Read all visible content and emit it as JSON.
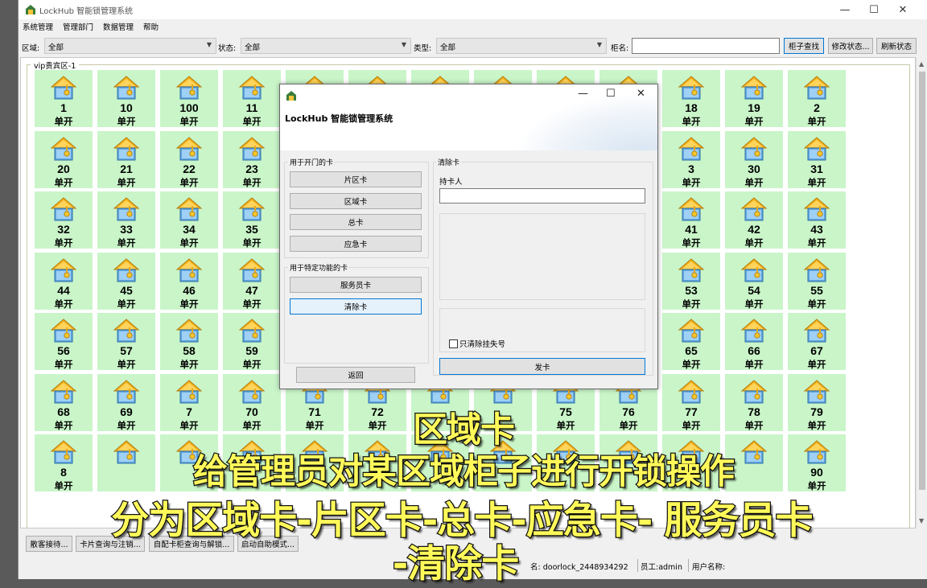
{
  "app": {
    "title": "LockHub 智能锁管理系统"
  },
  "menu": [
    "系统管理",
    "管理部门",
    "数据管理",
    "帮助"
  ],
  "filters": {
    "area_label": "区域:",
    "area_value": "全部",
    "status_label": "状态:",
    "status_value": "全部",
    "type_label": "类型:",
    "type_value": "全部",
    "cabinet_label": "柜名:",
    "cabinet_value": "",
    "search_btn": "柜子查找",
    "modify_btn": "修改状态...",
    "refresh_btn": "刷新状态"
  },
  "group_label": "vip贵宾区-1",
  "cabinets": [
    [
      "1",
      "10",
      "100",
      "11",
      "",
      "",
      "",
      "",
      "",
      "",
      "18",
      "19",
      "2"
    ],
    [
      "20",
      "21",
      "22",
      "23",
      "",
      "",
      "",
      "",
      "",
      "",
      "3",
      "30",
      "31"
    ],
    [
      "32",
      "33",
      "34",
      "35",
      "",
      "",
      "",
      "",
      "",
      "",
      "41",
      "42",
      "43"
    ],
    [
      "44",
      "45",
      "46",
      "47",
      "",
      "",
      "",
      "",
      "",
      "",
      "53",
      "54",
      "55"
    ],
    [
      "56",
      "57",
      "58",
      "59",
      "",
      "",
      "",
      "",
      "",
      "",
      "65",
      "66",
      "67"
    ],
    [
      "68",
      "69",
      "7",
      "70",
      "71",
      "72",
      "",
      "",
      "75",
      "76",
      "77",
      "78",
      "79"
    ],
    [
      "8",
      "",
      "",
      "",
      "",
      "",
      "",
      "",
      "",
      "",
      "",
      "",
      "90"
    ]
  ],
  "cabinet_mode": "单开",
  "bottom_buttons": [
    "散客接待...",
    "卡片查询与注销...",
    "自配卡柜查询与解锁...",
    "启动自助模式..."
  ],
  "status": {
    "db": "名: doorlock_2448934292",
    "staff": "员工:admin",
    "user": "用户名称:"
  },
  "dialog": {
    "title": "LockHub 智能锁管理系统",
    "open_group": "用于开门的卡",
    "open_buttons": [
      "片区卡",
      "区域卡",
      "总卡",
      "应急卡"
    ],
    "special_group": "用于特定功能的卡",
    "special_buttons": [
      "服务员卡",
      "清除卡"
    ],
    "back_btn": "返回",
    "clear_group": "清除卡",
    "holder_label": "持卡人",
    "holder_value": "",
    "only_lost_label": "只清除挂失号",
    "issue_btn": "发卡"
  },
  "caption": {
    "line1": "区域卡",
    "line2": "给管理员对某区域柜子进行开锁操作",
    "line3": "分为区域卡-片区卡-总卡-应急卡- 服务员卡",
    "line4": "-清除卡"
  },
  "colors": {
    "cabinet_bg": "#c9f5c9",
    "caption_text": "#fff95a",
    "focus_border": "#0078d7"
  }
}
